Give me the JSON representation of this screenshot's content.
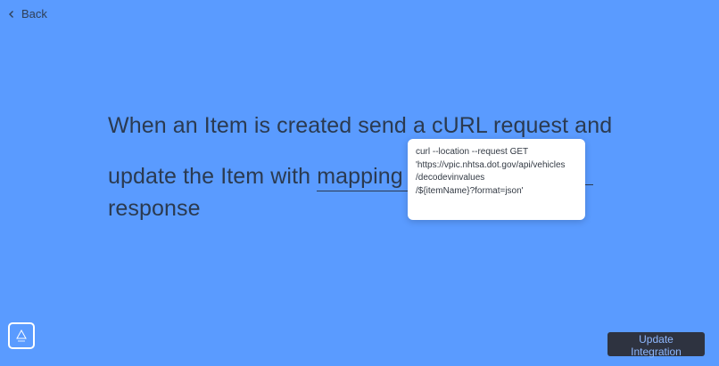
{
  "nav": {
    "back_label": "Back"
  },
  "sentence": {
    "part1": "When an Item is created send a ",
    "link1": "cURL request",
    "part2": " and",
    "part3": "update the Item with ",
    "link2": "mapping",
    "link3": " ru",
    "part4": "response"
  },
  "popover": {
    "code": "curl --location --request GET\n'https://vpic.nhtsa.dot.gov/api/vehicles\n/decodevinvalues\n/${itemName}?format=json'"
  },
  "footer": {
    "update_label": "Update Integration"
  },
  "colors": {
    "background": "#5a9bff",
    "text": "#2b3a50",
    "button_bg": "#2e3340",
    "button_text": "#8fb8ff"
  }
}
